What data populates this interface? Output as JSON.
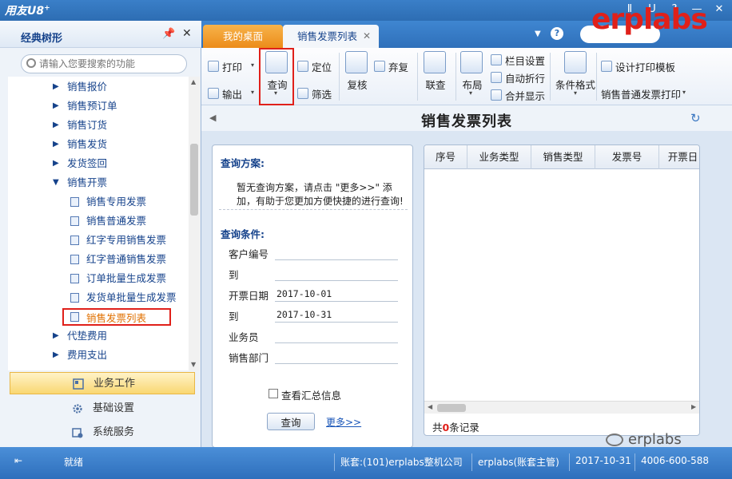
{
  "app": {
    "title": "用友U8",
    "title_sup": "+"
  },
  "window_controls": [
    "Ⅱ",
    "U",
    "?",
    "—",
    "✕"
  ],
  "watermark": "erplabs",
  "watermark_bottom": "erplabs",
  "left_panel": {
    "title": "经典树形",
    "search_placeholder": "请输入您要搜索的功能",
    "tree": [
      {
        "label": "销售报价",
        "type": "folder"
      },
      {
        "label": "销售预订单",
        "type": "folder"
      },
      {
        "label": "销售订货",
        "type": "folder"
      },
      {
        "label": "销售发货",
        "type": "folder"
      },
      {
        "label": "发货签回",
        "type": "folder"
      },
      {
        "label": "销售开票",
        "type": "folder-open"
      },
      {
        "label": "销售专用发票",
        "type": "leaf"
      },
      {
        "label": "销售普通发票",
        "type": "leaf"
      },
      {
        "label": "红字专用销售发票",
        "type": "leaf"
      },
      {
        "label": "红字普通销售发票",
        "type": "leaf"
      },
      {
        "label": "订单批量生成发票",
        "type": "leaf"
      },
      {
        "label": "发货单批量生成发票",
        "type": "leaf"
      },
      {
        "label": "销售发票列表",
        "type": "leaf",
        "selected": true
      },
      {
        "label": "代垫费用",
        "type": "folder"
      },
      {
        "label": "费用支出",
        "type": "folder"
      }
    ],
    "modules": [
      {
        "label": "业务工作",
        "icon": "business-work-icon",
        "active": true
      },
      {
        "label": "基础设置",
        "icon": "gear-icon",
        "active": false
      },
      {
        "label": "系统服务",
        "icon": "system-service-icon",
        "active": false
      }
    ]
  },
  "tabs": [
    {
      "label": "我的桌面",
      "active": false
    },
    {
      "label": "销售发票列表",
      "active": true
    }
  ],
  "toolbar": {
    "print": "打印",
    "export": "输出",
    "query": "查询",
    "locate": "定位",
    "filter": "筛选",
    "review": "复核",
    "abandon": "弃复",
    "linked_query": "联查",
    "layout": "布局",
    "column_settings": "栏目设置",
    "auto_wrap": "自动折行",
    "merge_display": "合并显示",
    "conditional_format": "条件格式",
    "design_print_template": "设计打印模板",
    "print_template_select": "销售普通发票打印"
  },
  "page_title": "销售发票列表",
  "query_panel": {
    "scheme_heading": "查询方案:",
    "scheme_note": "暂无查询方案，请点击 \"更多>>\" 添加，有助于您更加方便快捷的进行查询!",
    "conditions_heading": "查询条件:",
    "fields": [
      {
        "label": "客户编号",
        "value": ""
      },
      {
        "label": "到",
        "value": ""
      },
      {
        "label": "开票日期",
        "value": "2017-10-01"
      },
      {
        "label": "到",
        "value": "2017-10-31"
      },
      {
        "label": "业务员",
        "value": ""
      },
      {
        "label": "销售部门",
        "value": ""
      }
    ],
    "summary_checkbox": "查看汇总信息",
    "query_button": "查询",
    "more_link": "更多>>"
  },
  "grid": {
    "columns": [
      "序号",
      "业务类型",
      "销售类型",
      "发票号",
      "开票日"
    ],
    "count_prefix": "共",
    "count": "0",
    "count_suffix": "条记录"
  },
  "status": {
    "state": "就绪",
    "account": "账套:(101)erplabs整机公司",
    "user": "erplabs(账套主管)",
    "date": "2017-10-31",
    "phone": "4006-600-588"
  }
}
